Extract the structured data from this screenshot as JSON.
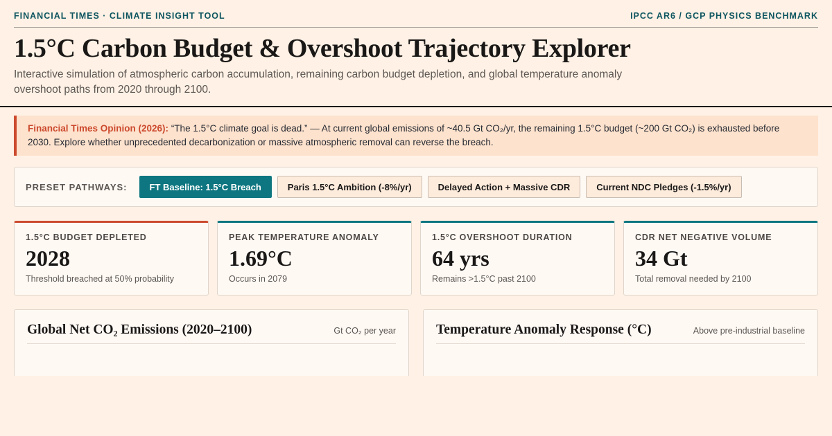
{
  "header": {
    "brand": "Financial Times · Climate Insight Tool",
    "benchmark": "IPCC AR6 / GCP Physics Benchmark",
    "title": "1.5°C Carbon Budget & Overshoot Trajectory Explorer",
    "subtitle": "Interactive simulation of atmospheric carbon accumulation, remaining carbon budget depletion, and global temperature anomaly overshoot paths from 2020 through 2100."
  },
  "opinion": {
    "label": "Financial Times Opinion (2026):",
    "text": " “The 1.5°C climate goal is dead.” — At current global emissions of ~40.5 Gt CO₂/yr, the remaining 1.5°C budget (~200 Gt CO₂) is exhausted before 2030. Explore whether unprecedented decarbonization or massive atmospheric removal can reverse the breach."
  },
  "presets": {
    "label": "Preset Pathways:",
    "buttons": [
      {
        "label": "FT Baseline: 1.5°C Breach",
        "active": true
      },
      {
        "label": "Paris 1.5°C Ambition (-8%/yr)",
        "active": false
      },
      {
        "label": "Delayed Action + Massive CDR",
        "active": false
      },
      {
        "label": "Current NDC Pledges (-1.5%/yr)",
        "active": false
      }
    ]
  },
  "kpis": [
    {
      "label": "1.5°C Budget Depleted",
      "value": "2028",
      "note": "Threshold breached at 50% probability",
      "accent": "#cc4a2e"
    },
    {
      "label": "Peak Temperature Anomaly",
      "value": "1.69°C",
      "note": "Occurs in 2079",
      "accent": "#0d7680"
    },
    {
      "label": "1.5°C Overshoot Duration",
      "value": "64 yrs",
      "note": "Remains >1.5°C past 2100",
      "accent": "#0d7680"
    },
    {
      "label": "CDR Net Negative Volume",
      "value": "34 Gt",
      "note": "Total removal needed by 2100",
      "accent": "#0d7680"
    }
  ],
  "panels": {
    "emissions": {
      "title": "Global Net CO₂ Emissions (2020–2100)",
      "unit": "Gt CO₂ per year"
    },
    "temperature": {
      "title": "Temperature Anomaly Response (°C)",
      "unit": "Above pre-industrial baseline"
    }
  },
  "colors": {
    "background": "#fff1e5",
    "accent_teal": "#0d7680",
    "accent_red": "#cc4a2e",
    "ink": "#1a1817"
  }
}
